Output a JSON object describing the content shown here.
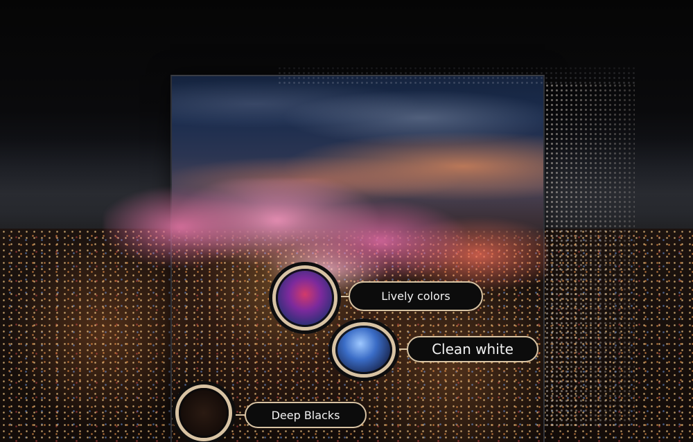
{
  "scene": {
    "description_icon": "tv-cityscape-image",
    "accent_color": "#d8c3a3",
    "label_background": "#0c0c0c"
  },
  "callouts": {
    "lively": {
      "label": "Lively colors"
    },
    "white": {
      "label": "Clean white"
    },
    "black": {
      "label": "Deep Blacks"
    }
  }
}
